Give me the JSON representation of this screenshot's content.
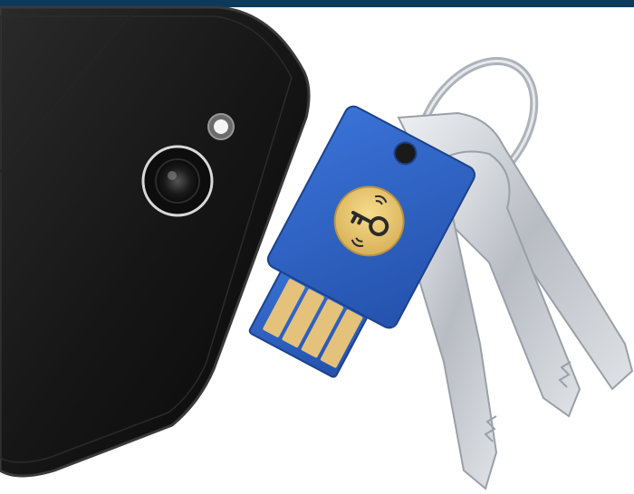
{
  "image": {
    "subject": "",
    "colors": {
      "top_bar": "#0b3a5c",
      "background": "#ffffff",
      "phone_body": "#121212",
      "security_key": "#2f63c4",
      "key_button": "#e9c66a",
      "usb_contacts": "#e4c27c",
      "metal": "#c9ccd1"
    }
  }
}
